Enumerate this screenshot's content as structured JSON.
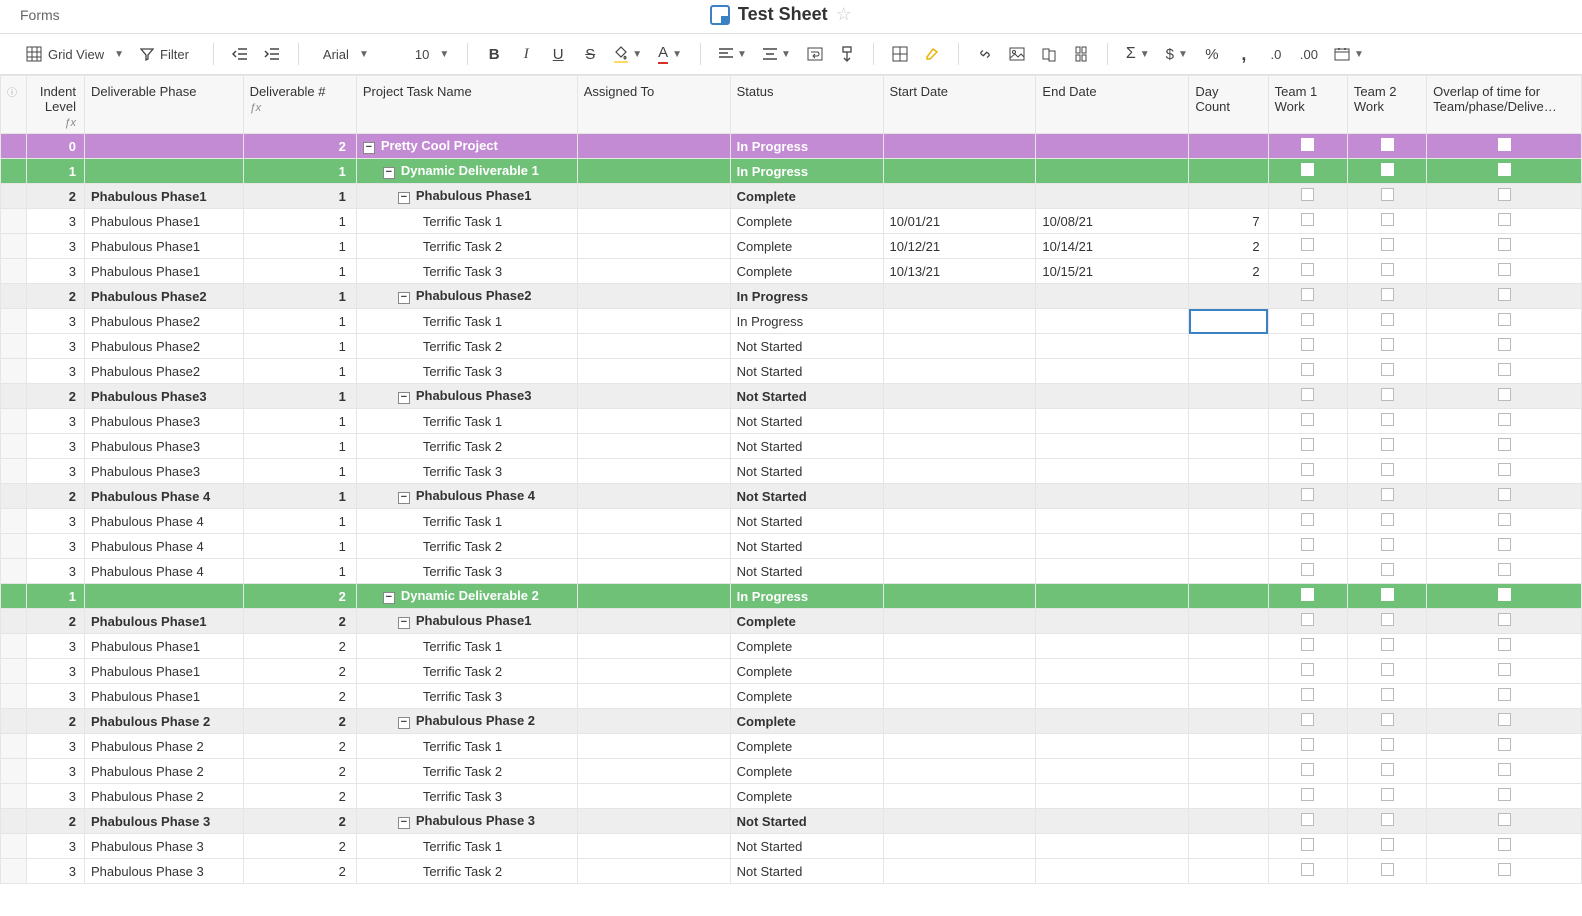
{
  "header": {
    "forms": "Forms",
    "title": "Test Sheet"
  },
  "toolbar": {
    "gridView": "Grid View",
    "filter": "Filter",
    "font": "Arial",
    "fontSize": "10"
  },
  "columns": {
    "indent": "Indent Level",
    "phase": "Deliverable Phase",
    "deliv": "Deliverable #",
    "task": "Project Task Name",
    "assign": "Assigned To",
    "status": "Status",
    "sdate": "Start Date",
    "edate": "End Date",
    "day": "Day Count",
    "t1": "Team 1 Work",
    "t2": "Team 2 Work",
    "overlap": "Overlap of time for Team/phase/Delive…"
  },
  "rows": [
    {
      "type": "purple",
      "indent": "0",
      "phase": "",
      "deliv": "2",
      "task": "Pretty Cool Project",
      "status": "In Progress",
      "sdate": "",
      "edate": "",
      "day": "",
      "ti": 0,
      "collapse": true,
      "bold": true,
      "cbWhite": true
    },
    {
      "type": "green",
      "indent": "1",
      "phase": "",
      "deliv": "1",
      "task": "Dynamic Deliverable 1",
      "status": "In Progress",
      "sdate": "",
      "edate": "",
      "day": "",
      "ti": 1,
      "collapse": true,
      "bold": true,
      "cbWhite": true
    },
    {
      "type": "grey",
      "indent": "2",
      "phase": "Phabulous Phase1",
      "deliv": "1",
      "task": "Phabulous Phase1",
      "status": "Complete",
      "sdate": "",
      "edate": "",
      "day": "",
      "ti": 2,
      "collapse": true,
      "bold": true
    },
    {
      "type": "",
      "indent": "3",
      "phase": "Phabulous Phase1",
      "deliv": "1",
      "task": "Terrific Task 1",
      "status": "Complete",
      "sdate": "10/01/21",
      "edate": "10/08/21",
      "day": "7",
      "ti": 3
    },
    {
      "type": "",
      "indent": "3",
      "phase": "Phabulous Phase1",
      "deliv": "1",
      "task": "Terrific Task 2",
      "status": "Complete",
      "sdate": "10/12/21",
      "edate": "10/14/21",
      "day": "2",
      "ti": 3
    },
    {
      "type": "",
      "indent": "3",
      "phase": "Phabulous Phase1",
      "deliv": "1",
      "task": "Terrific Task 3",
      "status": "Complete",
      "sdate": "10/13/21",
      "edate": "10/15/21",
      "day": "2",
      "ti": 3
    },
    {
      "type": "grey",
      "indent": "2",
      "phase": "Phabulous Phase2",
      "deliv": "1",
      "task": "Phabulous Phase2",
      "status": "In Progress",
      "sdate": "",
      "edate": "",
      "day": "",
      "ti": 2,
      "collapse": true,
      "bold": true
    },
    {
      "type": "",
      "indent": "3",
      "phase": "Phabulous Phase2",
      "deliv": "1",
      "task": "Terrific Task 1",
      "status": "In Progress",
      "sdate": "",
      "edate": "",
      "day": "",
      "ti": 3,
      "selected": true
    },
    {
      "type": "",
      "indent": "3",
      "phase": "Phabulous Phase2",
      "deliv": "1",
      "task": "Terrific Task 2",
      "status": "Not Started",
      "sdate": "",
      "edate": "",
      "day": "",
      "ti": 3
    },
    {
      "type": "",
      "indent": "3",
      "phase": "Phabulous Phase2",
      "deliv": "1",
      "task": "Terrific Task 3",
      "status": "Not Started",
      "sdate": "",
      "edate": "",
      "day": "",
      "ti": 3
    },
    {
      "type": "grey",
      "indent": "2",
      "phase": "Phabulous Phase3",
      "deliv": "1",
      "task": "Phabulous Phase3",
      "status": "Not Started",
      "sdate": "",
      "edate": "",
      "day": "",
      "ti": 2,
      "collapse": true,
      "bold": true
    },
    {
      "type": "",
      "indent": "3",
      "phase": "Phabulous Phase3",
      "deliv": "1",
      "task": "Terrific Task 1",
      "status": "Not Started",
      "sdate": "",
      "edate": "",
      "day": "",
      "ti": 3
    },
    {
      "type": "",
      "indent": "3",
      "phase": "Phabulous Phase3",
      "deliv": "1",
      "task": "Terrific Task 2",
      "status": "Not Started",
      "sdate": "",
      "edate": "",
      "day": "",
      "ti": 3
    },
    {
      "type": "",
      "indent": "3",
      "phase": "Phabulous Phase3",
      "deliv": "1",
      "task": "Terrific Task 3",
      "status": "Not Started",
      "sdate": "",
      "edate": "",
      "day": "",
      "ti": 3
    },
    {
      "type": "grey",
      "indent": "2",
      "phase": "Phabulous Phase 4",
      "deliv": "1",
      "task": "Phabulous Phase 4",
      "status": "Not Started",
      "sdate": "",
      "edate": "",
      "day": "",
      "ti": 2,
      "collapse": true,
      "bold": true
    },
    {
      "type": "",
      "indent": "3",
      "phase": "Phabulous Phase 4",
      "deliv": "1",
      "task": "Terrific Task 1",
      "status": "Not Started",
      "sdate": "",
      "edate": "",
      "day": "",
      "ti": 3
    },
    {
      "type": "",
      "indent": "3",
      "phase": "Phabulous Phase 4",
      "deliv": "1",
      "task": "Terrific Task 2",
      "status": "Not Started",
      "sdate": "",
      "edate": "",
      "day": "",
      "ti": 3
    },
    {
      "type": "",
      "indent": "3",
      "phase": "Phabulous Phase 4",
      "deliv": "1",
      "task": "Terrific Task 3",
      "status": "Not Started",
      "sdate": "",
      "edate": "",
      "day": "",
      "ti": 3
    },
    {
      "type": "green",
      "indent": "1",
      "phase": "",
      "deliv": "2",
      "task": "Dynamic Deliverable 2",
      "status": "In Progress",
      "sdate": "",
      "edate": "",
      "day": "",
      "ti": 1,
      "collapse": true,
      "bold": true,
      "cbWhite": true
    },
    {
      "type": "grey",
      "indent": "2",
      "phase": "Phabulous Phase1",
      "deliv": "2",
      "task": "Phabulous Phase1",
      "status": "Complete",
      "sdate": "",
      "edate": "",
      "day": "",
      "ti": 2,
      "collapse": true,
      "bold": true
    },
    {
      "type": "",
      "indent": "3",
      "phase": "Phabulous Phase1",
      "deliv": "2",
      "task": "Terrific Task 1",
      "status": "Complete",
      "sdate": "",
      "edate": "",
      "day": "",
      "ti": 3
    },
    {
      "type": "",
      "indent": "3",
      "phase": "Phabulous Phase1",
      "deliv": "2",
      "task": "Terrific Task 2",
      "status": "Complete",
      "sdate": "",
      "edate": "",
      "day": "",
      "ti": 3
    },
    {
      "type": "",
      "indent": "3",
      "phase": "Phabulous Phase1",
      "deliv": "2",
      "task": "Terrific Task 3",
      "status": "Complete",
      "sdate": "",
      "edate": "",
      "day": "",
      "ti": 3
    },
    {
      "type": "grey",
      "indent": "2",
      "phase": "Phabulous Phase 2",
      "deliv": "2",
      "task": "Phabulous Phase 2",
      "status": "Complete",
      "sdate": "",
      "edate": "",
      "day": "",
      "ti": 2,
      "collapse": true,
      "bold": true
    },
    {
      "type": "",
      "indent": "3",
      "phase": "Phabulous Phase 2",
      "deliv": "2",
      "task": "Terrific Task 1",
      "status": "Complete",
      "sdate": "",
      "edate": "",
      "day": "",
      "ti": 3
    },
    {
      "type": "",
      "indent": "3",
      "phase": "Phabulous Phase 2",
      "deliv": "2",
      "task": "Terrific Task 2",
      "status": "Complete",
      "sdate": "",
      "edate": "",
      "day": "",
      "ti": 3
    },
    {
      "type": "",
      "indent": "3",
      "phase": "Phabulous Phase 2",
      "deliv": "2",
      "task": "Terrific Task 3",
      "status": "Complete",
      "sdate": "",
      "edate": "",
      "day": "",
      "ti": 3
    },
    {
      "type": "grey",
      "indent": "2",
      "phase": "Phabulous Phase 3",
      "deliv": "2",
      "task": "Phabulous Phase 3",
      "status": "Not Started",
      "sdate": "",
      "edate": "",
      "day": "",
      "ti": 2,
      "collapse": true,
      "bold": true
    },
    {
      "type": "",
      "indent": "3",
      "phase": "Phabulous Phase 3",
      "deliv": "2",
      "task": "Terrific Task 1",
      "status": "Not Started",
      "sdate": "",
      "edate": "",
      "day": "",
      "ti": 3
    },
    {
      "type": "",
      "indent": "3",
      "phase": "Phabulous Phase 3",
      "deliv": "2",
      "task": "Terrific Task 2",
      "status": "Not Started",
      "sdate": "",
      "edate": "",
      "day": "",
      "ti": 3
    }
  ]
}
